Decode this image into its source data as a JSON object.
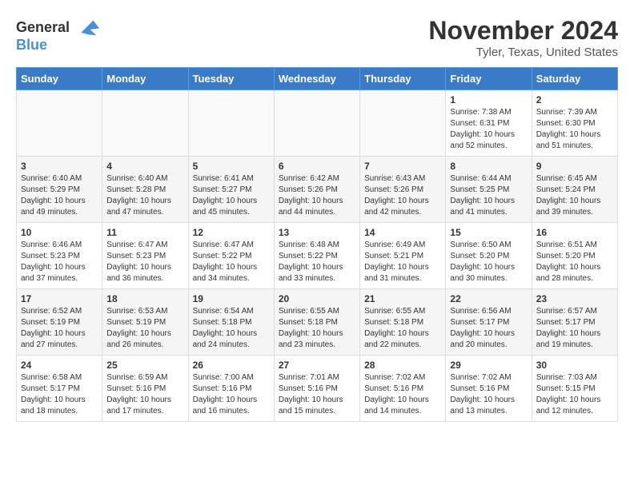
{
  "logo": {
    "line1": "General",
    "line2": "Blue"
  },
  "title": "November 2024",
  "location": "Tyler, Texas, United States",
  "days_header": [
    "Sunday",
    "Monday",
    "Tuesday",
    "Wednesday",
    "Thursday",
    "Friday",
    "Saturday"
  ],
  "weeks": [
    [
      {
        "day": "",
        "info": ""
      },
      {
        "day": "",
        "info": ""
      },
      {
        "day": "",
        "info": ""
      },
      {
        "day": "",
        "info": ""
      },
      {
        "day": "",
        "info": ""
      },
      {
        "day": "1",
        "info": "Sunrise: 7:38 AM\nSunset: 6:31 PM\nDaylight: 10 hours\nand 52 minutes."
      },
      {
        "day": "2",
        "info": "Sunrise: 7:39 AM\nSunset: 6:30 PM\nDaylight: 10 hours\nand 51 minutes."
      }
    ],
    [
      {
        "day": "3",
        "info": "Sunrise: 6:40 AM\nSunset: 5:29 PM\nDaylight: 10 hours\nand 49 minutes."
      },
      {
        "day": "4",
        "info": "Sunrise: 6:40 AM\nSunset: 5:28 PM\nDaylight: 10 hours\nand 47 minutes."
      },
      {
        "day": "5",
        "info": "Sunrise: 6:41 AM\nSunset: 5:27 PM\nDaylight: 10 hours\nand 45 minutes."
      },
      {
        "day": "6",
        "info": "Sunrise: 6:42 AM\nSunset: 5:26 PM\nDaylight: 10 hours\nand 44 minutes."
      },
      {
        "day": "7",
        "info": "Sunrise: 6:43 AM\nSunset: 5:26 PM\nDaylight: 10 hours\nand 42 minutes."
      },
      {
        "day": "8",
        "info": "Sunrise: 6:44 AM\nSunset: 5:25 PM\nDaylight: 10 hours\nand 41 minutes."
      },
      {
        "day": "9",
        "info": "Sunrise: 6:45 AM\nSunset: 5:24 PM\nDaylight: 10 hours\nand 39 minutes."
      }
    ],
    [
      {
        "day": "10",
        "info": "Sunrise: 6:46 AM\nSunset: 5:23 PM\nDaylight: 10 hours\nand 37 minutes."
      },
      {
        "day": "11",
        "info": "Sunrise: 6:47 AM\nSunset: 5:23 PM\nDaylight: 10 hours\nand 36 minutes."
      },
      {
        "day": "12",
        "info": "Sunrise: 6:47 AM\nSunset: 5:22 PM\nDaylight: 10 hours\nand 34 minutes."
      },
      {
        "day": "13",
        "info": "Sunrise: 6:48 AM\nSunset: 5:22 PM\nDaylight: 10 hours\nand 33 minutes."
      },
      {
        "day": "14",
        "info": "Sunrise: 6:49 AM\nSunset: 5:21 PM\nDaylight: 10 hours\nand 31 minutes."
      },
      {
        "day": "15",
        "info": "Sunrise: 6:50 AM\nSunset: 5:20 PM\nDaylight: 10 hours\nand 30 minutes."
      },
      {
        "day": "16",
        "info": "Sunrise: 6:51 AM\nSunset: 5:20 PM\nDaylight: 10 hours\nand 28 minutes."
      }
    ],
    [
      {
        "day": "17",
        "info": "Sunrise: 6:52 AM\nSunset: 5:19 PM\nDaylight: 10 hours\nand 27 minutes."
      },
      {
        "day": "18",
        "info": "Sunrise: 6:53 AM\nSunset: 5:19 PM\nDaylight: 10 hours\nand 26 minutes."
      },
      {
        "day": "19",
        "info": "Sunrise: 6:54 AM\nSunset: 5:18 PM\nDaylight: 10 hours\nand 24 minutes."
      },
      {
        "day": "20",
        "info": "Sunrise: 6:55 AM\nSunset: 5:18 PM\nDaylight: 10 hours\nand 23 minutes."
      },
      {
        "day": "21",
        "info": "Sunrise: 6:55 AM\nSunset: 5:18 PM\nDaylight: 10 hours\nand 22 minutes."
      },
      {
        "day": "22",
        "info": "Sunrise: 6:56 AM\nSunset: 5:17 PM\nDaylight: 10 hours\nand 20 minutes."
      },
      {
        "day": "23",
        "info": "Sunrise: 6:57 AM\nSunset: 5:17 PM\nDaylight: 10 hours\nand 19 minutes."
      }
    ],
    [
      {
        "day": "24",
        "info": "Sunrise: 6:58 AM\nSunset: 5:17 PM\nDaylight: 10 hours\nand 18 minutes."
      },
      {
        "day": "25",
        "info": "Sunrise: 6:59 AM\nSunset: 5:16 PM\nDaylight: 10 hours\nand 17 minutes."
      },
      {
        "day": "26",
        "info": "Sunrise: 7:00 AM\nSunset: 5:16 PM\nDaylight: 10 hours\nand 16 minutes."
      },
      {
        "day": "27",
        "info": "Sunrise: 7:01 AM\nSunset: 5:16 PM\nDaylight: 10 hours\nand 15 minutes."
      },
      {
        "day": "28",
        "info": "Sunrise: 7:02 AM\nSunset: 5:16 PM\nDaylight: 10 hours\nand 14 minutes."
      },
      {
        "day": "29",
        "info": "Sunrise: 7:02 AM\nSunset: 5:16 PM\nDaylight: 10 hours\nand 13 minutes."
      },
      {
        "day": "30",
        "info": "Sunrise: 7:03 AM\nSunset: 5:15 PM\nDaylight: 10 hours\nand 12 minutes."
      }
    ]
  ]
}
